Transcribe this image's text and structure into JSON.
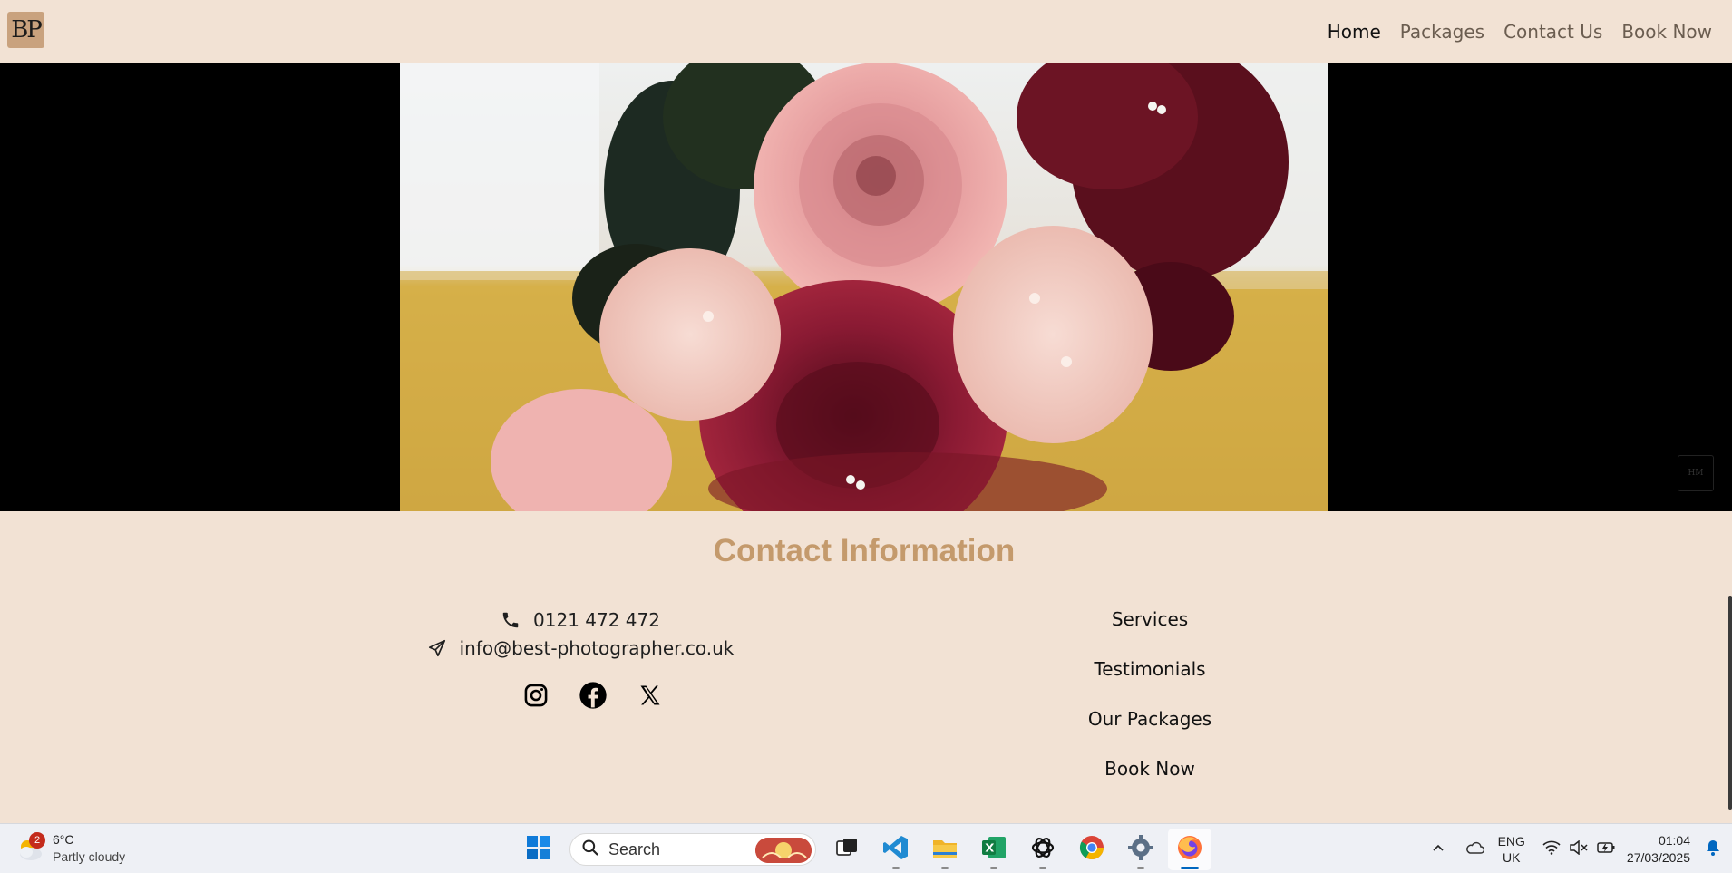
{
  "navbar": {
    "logo": "BP",
    "links": [
      "Home",
      "Packages",
      "Contact Us",
      "Book Now"
    ],
    "active": "Home"
  },
  "video": {
    "watermark": "HM"
  },
  "contact": {
    "title": "Contact Information",
    "phone": "0121 472 472",
    "email": "info@best-photographer.co.uk",
    "socials": [
      "instagram-icon",
      "facebook-icon",
      "x-icon"
    ],
    "links": [
      "Services",
      "Testimonials",
      "Our Packages",
      "Book Now"
    ]
  },
  "taskbar": {
    "weather": {
      "badge": "2",
      "temp": "6°C",
      "condition": "Partly cloudy"
    },
    "search_placeholder": "Search",
    "apps": [
      "start-icon",
      "task-view-icon",
      "vscode-icon",
      "file-explorer-icon",
      "excel-icon",
      "chatgpt-icon",
      "chrome-icon",
      "settings-icon",
      "firefox-icon"
    ],
    "lang_line1": "ENG",
    "lang_line2": "UK",
    "time": "01:04",
    "date": "27/03/2025"
  },
  "colors": {
    "page_bg": "#f2e2d4",
    "accent": "#c49a6c",
    "logo_bg": "#c9a27e"
  }
}
